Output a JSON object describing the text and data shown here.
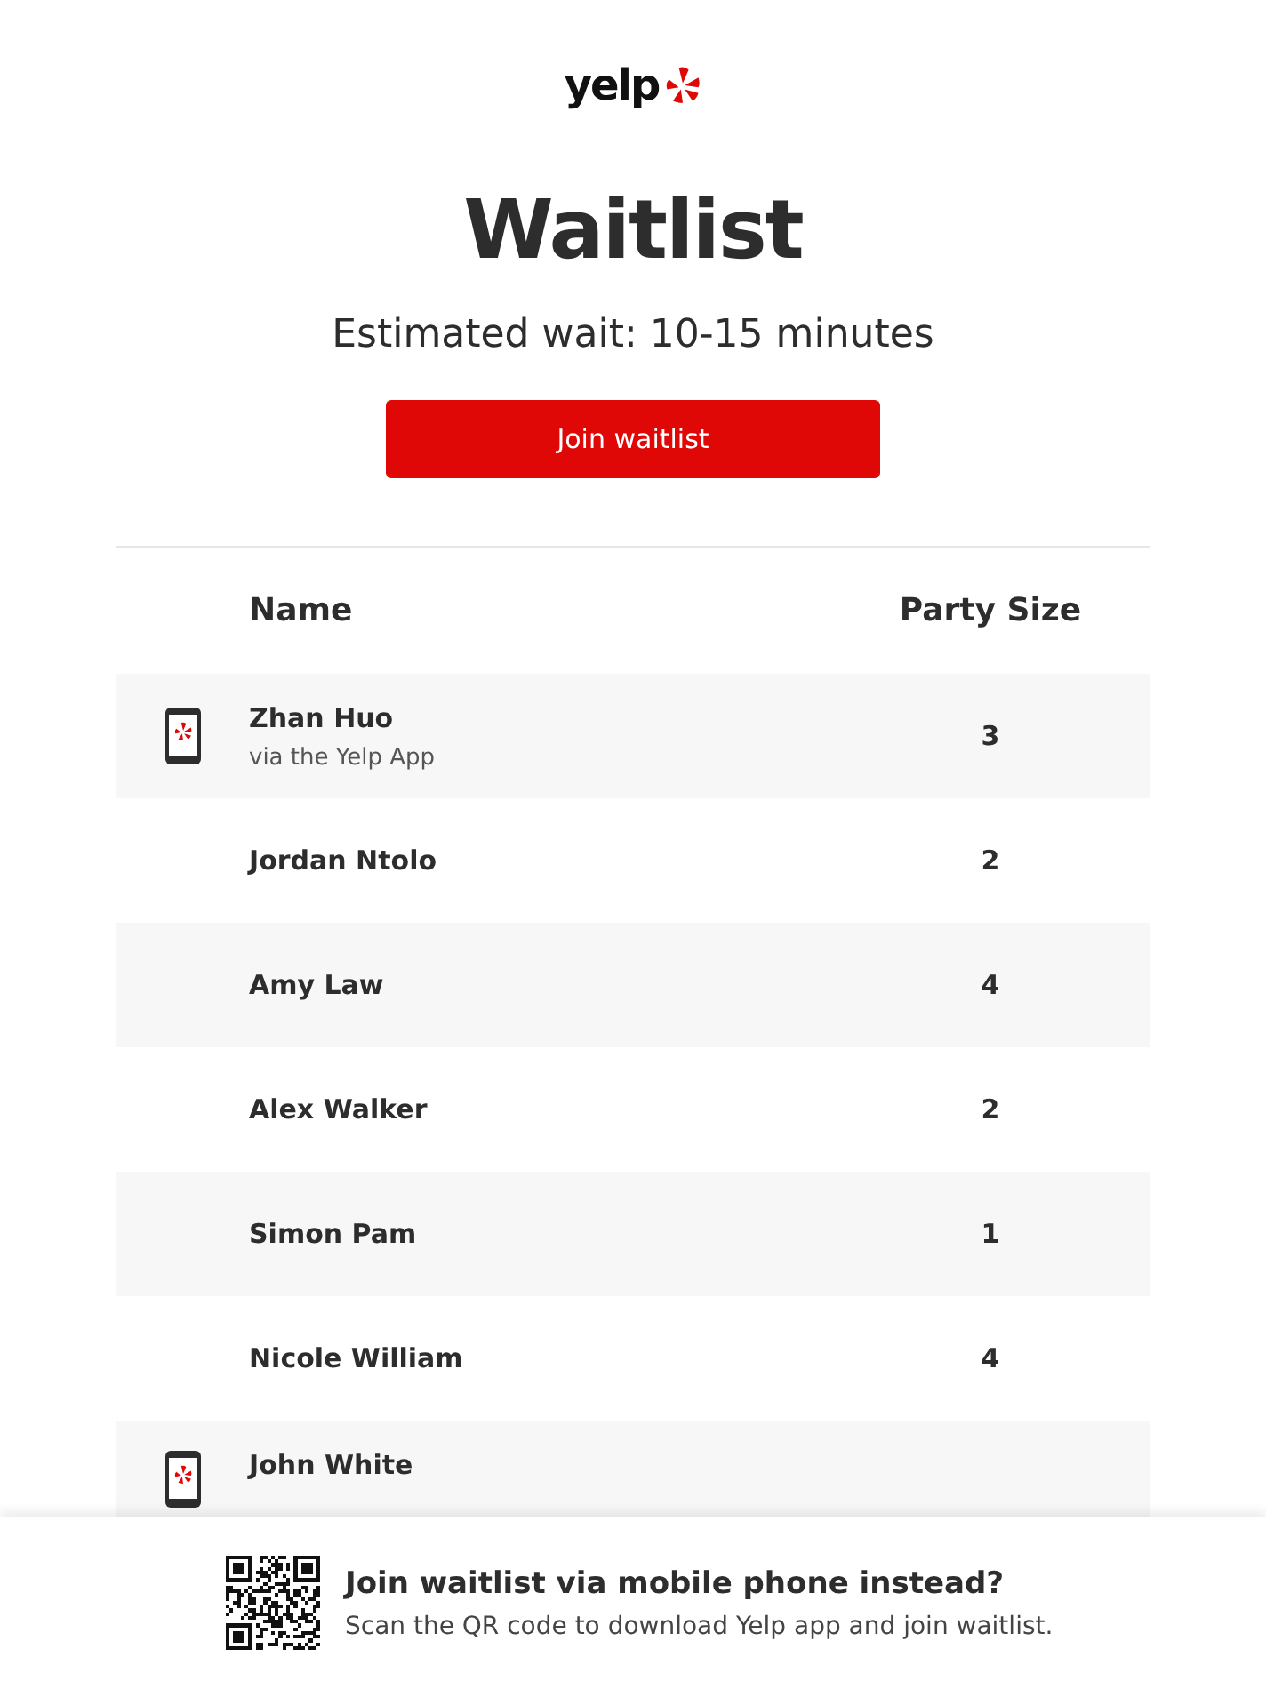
{
  "logo": {
    "text": "yelp"
  },
  "title": "Waitlist",
  "estimate": "Estimated wait: 10-15 minutes",
  "join_button": "Join waitlist",
  "table": {
    "columns": [
      "Name",
      "Party Size"
    ],
    "rows": [
      {
        "name": "Zhan Huo",
        "source": "via the Yelp App",
        "party_size": "3",
        "kind": "app"
      },
      {
        "name": "Jordan Ntolo",
        "party_size": "2",
        "kind": "walkin"
      },
      {
        "name": "Amy Law",
        "party_size": "4",
        "kind": "walkin"
      },
      {
        "name": "Alex Walker",
        "party_size": "2",
        "kind": "walkin"
      },
      {
        "name": "Simon Pam",
        "party_size": "1",
        "kind": "walkin"
      },
      {
        "name": "Nicole William",
        "party_size": "4",
        "kind": "walkin"
      },
      {
        "name": "John White",
        "kind": "app"
      }
    ]
  },
  "footer": {
    "heading": "Join waitlist via mobile phone instead?",
    "text": "Scan the QR code to download Yelp app and join waitlist."
  }
}
